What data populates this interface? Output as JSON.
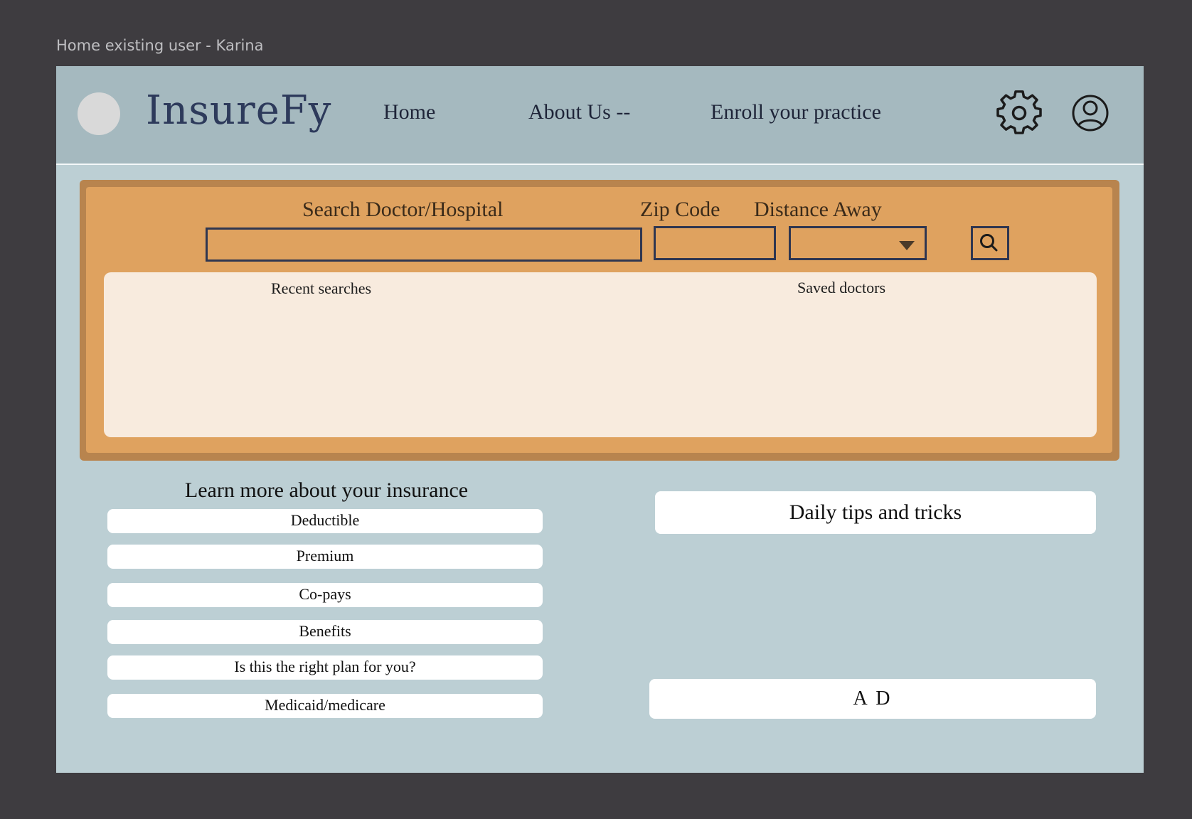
{
  "frame_label": "Home existing user - Karina",
  "header": {
    "brand": "InsureFy",
    "nav": [
      {
        "label": "Home"
      },
      {
        "label": "About Us --"
      },
      {
        "label": "Enroll your practice"
      }
    ],
    "settings_icon": "gear-icon",
    "profile_icon": "user-circle-icon"
  },
  "search": {
    "doctor_label": "Search Doctor/Hospital",
    "doctor_value": "",
    "zip_label": "Zip Code",
    "zip_value": "",
    "distance_label": "Distance Away",
    "distance_value": "",
    "search_icon": "search-icon",
    "recent_label": "Recent searches",
    "saved_label": "Saved doctors"
  },
  "learn": {
    "title": "Learn more about your insurance",
    "items": [
      {
        "label": "Deductible"
      },
      {
        "label": "Premium"
      },
      {
        "label": "Co-pays"
      },
      {
        "label": "Benefits"
      },
      {
        "label": "Is this the right plan for you?"
      },
      {
        "label": "Medicaid/medicare"
      }
    ]
  },
  "tips": {
    "title": "Daily tips and tricks"
  },
  "ad": {
    "label": "A D"
  },
  "colors": {
    "page_bg": "#3e3c40",
    "frame_bg": "#bccfd4",
    "header_bg": "#a5b9bf",
    "brand": "#2d3a5b",
    "panel_outer": "#b8844e",
    "panel_inner": "#dfa25f",
    "history_bg": "#f8ebde"
  }
}
